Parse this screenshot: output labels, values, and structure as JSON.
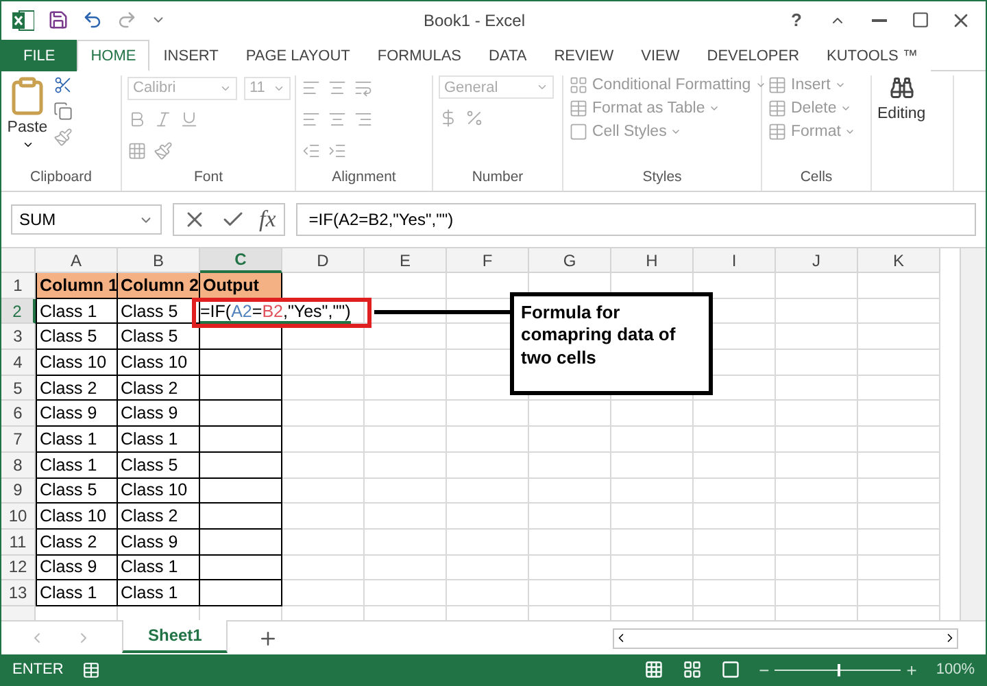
{
  "window": {
    "title": "Book1 - Excel",
    "help": "?"
  },
  "tabs": [
    {
      "label": "FILE",
      "kind": "file",
      "selected": false
    },
    {
      "label": "HOME",
      "kind": "tab",
      "selected": true
    },
    {
      "label": "INSERT",
      "kind": "tab",
      "selected": false
    },
    {
      "label": "PAGE LAYOUT",
      "kind": "tab",
      "selected": false
    },
    {
      "label": "FORMULAS",
      "kind": "tab",
      "selected": false
    },
    {
      "label": "DATA",
      "kind": "tab",
      "selected": false
    },
    {
      "label": "REVIEW",
      "kind": "tab",
      "selected": false
    },
    {
      "label": "VIEW",
      "kind": "tab",
      "selected": false
    },
    {
      "label": "DEVELOPER",
      "kind": "tab",
      "selected": false
    },
    {
      "label": "KUTOOLS ™",
      "kind": "tab",
      "selected": false
    }
  ],
  "ribbon": {
    "disabled": true,
    "paste": "Paste",
    "font_name": "Calibri",
    "font_size": "11",
    "number_format": "General",
    "styles": [
      "Conditional Formatting",
      "Format as Table",
      "Cell Styles"
    ],
    "cells": [
      "Insert",
      "Delete",
      "Format"
    ],
    "editing": "Editing",
    "groups": [
      "Clipboard",
      "Font",
      "Alignment",
      "Number",
      "Styles",
      "Cells"
    ]
  },
  "formula_bar": {
    "name_box": "SUM",
    "function_button": "fx",
    "formula": "=IF(A2=B2,\"Yes\",\"\")"
  },
  "columns": [
    {
      "label": "A",
      "selected": false
    },
    {
      "label": "B",
      "selected": false
    },
    {
      "label": "C",
      "selected": true
    },
    {
      "label": "D",
      "selected": false
    },
    {
      "label": "E",
      "selected": false
    },
    {
      "label": "F",
      "selected": false
    },
    {
      "label": "G",
      "selected": false
    },
    {
      "label": "H",
      "selected": false
    },
    {
      "label": "I",
      "selected": false
    },
    {
      "label": "J",
      "selected": false
    },
    {
      "label": "K",
      "selected": false
    }
  ],
  "header_row": {
    "number": "1",
    "selected": false,
    "cells": [
      "Column 1",
      "Column 2",
      "Output"
    ]
  },
  "rows": [
    {
      "number": "2",
      "selected": true,
      "cells": [
        "Class 1",
        "Class 5"
      ]
    },
    {
      "number": "3",
      "selected": false,
      "cells": [
        "Class 5",
        "Class 5"
      ]
    },
    {
      "number": "4",
      "selected": false,
      "cells": [
        "Class 10",
        "Class 10"
      ]
    },
    {
      "number": "5",
      "selected": false,
      "cells": [
        "Class 2",
        "Class 2"
      ]
    },
    {
      "number": "6",
      "selected": false,
      "cells": [
        "Class 9",
        "Class 9"
      ]
    },
    {
      "number": "7",
      "selected": false,
      "cells": [
        "Class 1",
        "Class 1"
      ]
    },
    {
      "number": "8",
      "selected": false,
      "cells": [
        "Class 1",
        "Class 5"
      ]
    },
    {
      "number": "9",
      "selected": false,
      "cells": [
        "Class 5",
        "Class 10"
      ]
    },
    {
      "number": "10",
      "selected": false,
      "cells": [
        "Class 10",
        "Class 2"
      ]
    },
    {
      "number": "11",
      "selected": false,
      "cells": [
        "Class 2",
        "Class 9"
      ]
    },
    {
      "number": "12",
      "selected": false,
      "cells": [
        "Class 9",
        "Class 1"
      ]
    },
    {
      "number": "13",
      "selected": false,
      "cells": [
        "Class 1",
        "Class 1"
      ]
    }
  ],
  "editing_cell": {
    "parts": [
      {
        "text": "=IF(",
        "color": "#000000"
      },
      {
        "text": "A2",
        "color": "#4f81bd"
      },
      {
        "text": "=",
        "color": "#000000"
      },
      {
        "text": "B2",
        "color": "#e0505a"
      },
      {
        "text": ",\"Yes\",\"\")",
        "color": "#000000"
      }
    ]
  },
  "callout": {
    "text": "Formula for comapring data of two cells"
  },
  "sheets": [
    {
      "label": "Sheet1",
      "selected": true
    }
  ],
  "status_bar": {
    "mode": "ENTER",
    "zoom": "100%",
    "zoom_slider": {
      "level": 0.5
    },
    "minus": "−",
    "plus": "+"
  }
}
